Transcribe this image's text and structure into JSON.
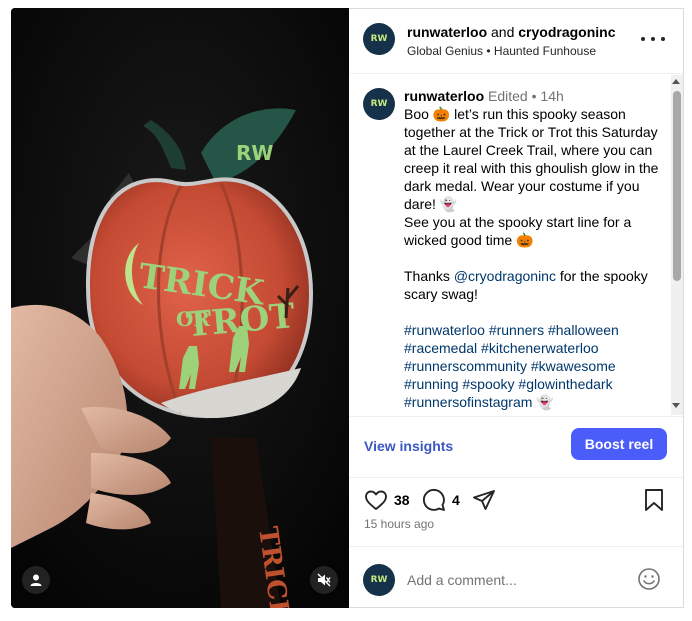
{
  "header": {
    "account_primary": "runwaterloo",
    "joiner": "and",
    "account_collab": "cryodragoninc",
    "subtitle": "Global Genius • Haunted Funhouse"
  },
  "avatar": {
    "initials": "RW"
  },
  "medal": {
    "text_line1": "TRICK",
    "text_line2": "OR",
    "text_line3": "TROT",
    "ribbon_text": "TRICK"
  },
  "caption": {
    "user": "runwaterloo",
    "edited": "Edited",
    "dot": "•",
    "time": "14h",
    "line1": "Boo 🎃 let’s run this spooky season together at the Trick or Trot this Saturday at the Laurel Creek Trail, where you can creep it real with this ghoulish glow in the dark medal. Wear your costume if you dare! 👻",
    "line2": "See you at the spooky start line for a wicked good time 🎃",
    "thanks_prefix": "Thanks",
    "mention": "@cryodragoninc",
    "thanks_suffix": "for the spooky scary swag!",
    "hashtags": "#runwaterloo #runners #halloween #racemedal #kitchenerwaterloo #runnerscommunity #kwawesome #running #spooky #glowinthedark #runnersofinstagram 👻"
  },
  "insights": {
    "view_label": "View insights",
    "boost_label": "Boost reel"
  },
  "actions": {
    "likes": "38",
    "comments": "4",
    "time_ago": "15 hours ago"
  },
  "comment": {
    "placeholder": "Add a comment..."
  },
  "colors": {
    "accent_blue": "#4a5df9",
    "link_blue": "#00376b",
    "insights_blue": "#3b57c4",
    "avatar_bg": "#16324a"
  }
}
